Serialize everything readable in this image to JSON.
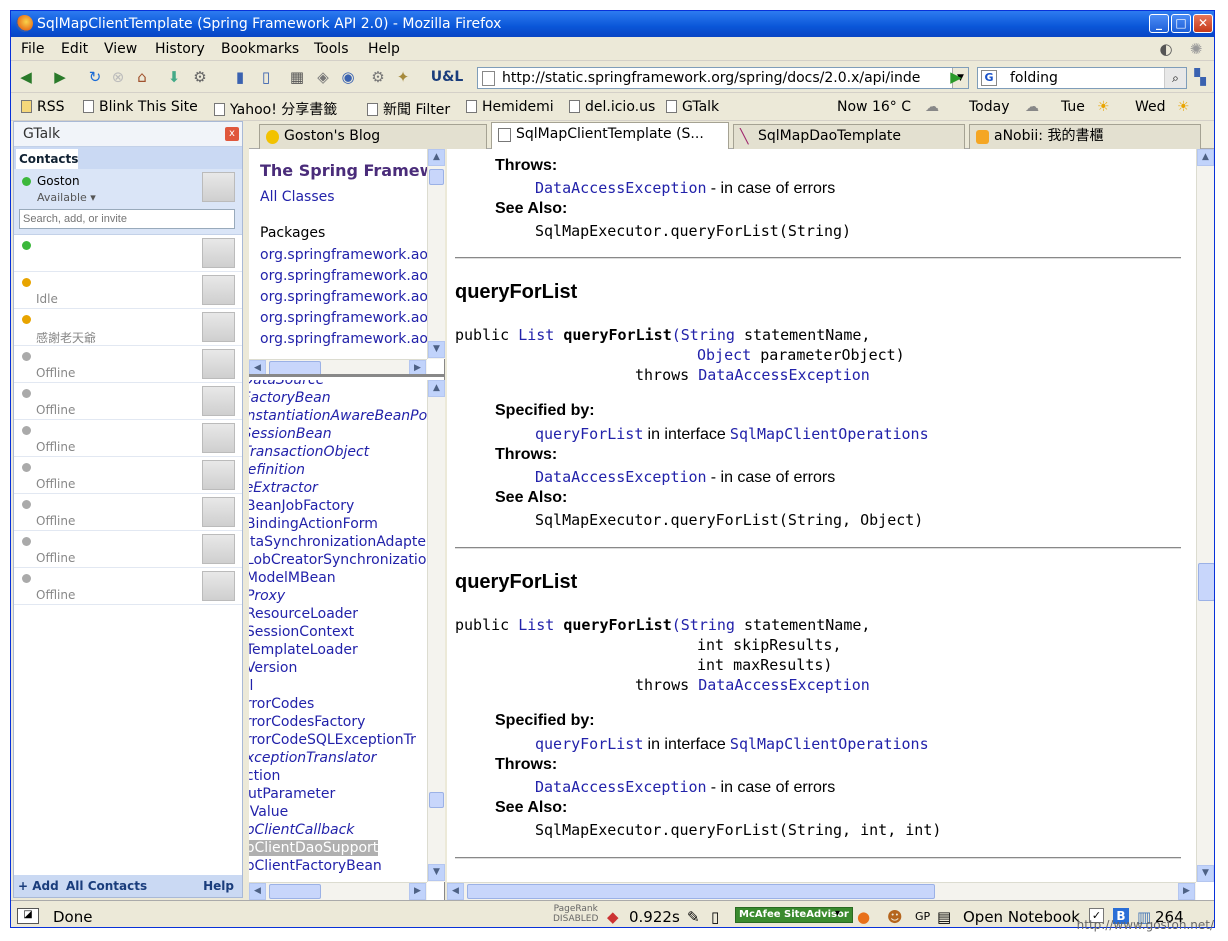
{
  "window": {
    "title": "SqlMapClientTemplate (Spring Framework API 2.0) - Mozilla Firefox"
  },
  "menu": [
    "File",
    "Edit",
    "View",
    "History",
    "Bookmarks",
    "Tools",
    "Help"
  ],
  "toolbar": {
    "url": "http://static.springframework.org/spring/docs/2.0.x/api/inde",
    "search_value": "folding",
    "search_engine": "G",
    "uql_label": "U&L"
  },
  "bookmarks": {
    "items": [
      "RSS",
      "Blink This Site",
      "Yahoo! 分享書籤",
      "新聞 Filter",
      "Hemidemi",
      "del.icio.us",
      "GTalk"
    ],
    "weather_now": "Now 16° C",
    "weather_today": "Today",
    "weather_tue": "Tue",
    "weather_wed": "Wed"
  },
  "gtalk": {
    "title": "GTalk",
    "close": "x",
    "tab": "Contacts",
    "me": {
      "name": "Goston",
      "status": "Available"
    },
    "search_placeholder": "Search, add, or invite",
    "contacts": [
      {
        "status": "",
        "presence": "online"
      },
      {
        "status": "Idle",
        "presence": "idle"
      },
      {
        "status": "感謝老天爺",
        "presence": "idle"
      },
      {
        "status": "Offline",
        "presence": "offline"
      },
      {
        "status": "Offline",
        "presence": "offline"
      },
      {
        "status": "Offline",
        "presence": "offline"
      },
      {
        "status": "Offline",
        "presence": "offline"
      },
      {
        "status": "Offline",
        "presence": "offline"
      },
      {
        "status": "Offline",
        "presence": "offline"
      },
      {
        "status": "Offline",
        "presence": "offline"
      }
    ],
    "footer": {
      "add": "+ Add",
      "all": "All Contacts",
      "help": "Help"
    }
  },
  "tabs": [
    {
      "label": "Goston's Blog",
      "active": false
    },
    {
      "label": "SqlMapClientTemplate (S...",
      "active": true
    },
    {
      "label": "SqlMapDaoTemplate",
      "active": false
    },
    {
      "label": "aNobii: 我的書櫃",
      "active": false
    }
  ],
  "package_frame": {
    "title": "The Spring Framewo",
    "all_classes": "All Classes",
    "packages_heading": "Packages",
    "packages": [
      "org.springframework.aop",
      "org.springframework.aop",
      "org.springframework.aop",
      "org.springframework.aop",
      "org.springframework.aop"
    ]
  },
  "class_frame": {
    "items": [
      {
        "text": "tDataSource",
        "italic": true
      },
      {
        "text": "tFactoryBean",
        "italic": true
      },
      {
        "text": "tInstantiationAwareBeanPo",
        "italic": true
      },
      {
        "text": "tSessionBean",
        "italic": true
      },
      {
        "text": "tTransactionObject",
        "italic": true
      },
      {
        "text": "Definition",
        "italic": true
      },
      {
        "text": "ceExtractor",
        "italic": true
      },
      {
        "text": "gBeanJobFactory",
        "italic": false
      },
      {
        "text": "gBindingActionForm",
        "italic": false
      },
      {
        "text": "gJtaSynchronizationAdapte",
        "italic": false
      },
      {
        "text": "gLobCreatorSynchronizatio",
        "italic": false
      },
      {
        "text": "gModelMBean",
        "italic": false
      },
      {
        "text": "gProxy",
        "italic": true
      },
      {
        "text": "gResourceLoader",
        "italic": false
      },
      {
        "text": "gSessionContext",
        "italic": false
      },
      {
        "text": "gTemplateLoader",
        "italic": false
      },
      {
        "text": "gVersion",
        "italic": false
      },
      {
        "text": "all",
        "italic": false
      },
      {
        "text": "ErrorCodes",
        "italic": false
      },
      {
        "text": "ErrorCodesFactory",
        "italic": false
      },
      {
        "text": "ErrorCodeSQLExceptionTr",
        "italic": false
      },
      {
        "text": "ExceptionTranslator",
        "italic": true
      },
      {
        "text": "nction",
        "italic": false
      },
      {
        "text": "OutParameter",
        "italic": false
      },
      {
        "text": "lbValue",
        "italic": false
      },
      {
        "text": "apClientCallback",
        "italic": true
      },
      {
        "text": "apClientDaoSupport",
        "italic": false,
        "selected": true
      },
      {
        "text": "apClientFactoryBean",
        "italic": false
      }
    ]
  },
  "doc": {
    "throws_label": "Throws:",
    "see_also_label": "See Also:",
    "specified_by_label": "Specified by:",
    "top": {
      "throws_exc": "DataAccessException",
      "throws_desc": "- in case of errors",
      "see_also": "SqlMapExecutor.queryForList(String)"
    },
    "methods": [
      {
        "heading": "queryForList",
        "sig_public": "public",
        "sig_type": "List",
        "sig_name": "queryForList",
        "sig_lines": [
          {
            "type": "(String",
            "rest": " statementName,"
          },
          {
            "type": "Object",
            "rest": " parameterObject)"
          }
        ],
        "throws_kw": "throws",
        "throws_exc": "DataAccessException",
        "specified_method": "queryForList",
        "specified_in": "in interface",
        "specified_iface": "SqlMapClientOperations",
        "throws_desc": "- in case of errors",
        "see_also": "SqlMapExecutor.queryForList(String, Object)"
      },
      {
        "heading": "queryForList",
        "sig_public": "public",
        "sig_type": "List",
        "sig_name": "queryForList",
        "sig_lines": [
          {
            "type": "(String",
            "rest": " statementName,"
          },
          {
            "type": "",
            "rest": "int skipResults,"
          },
          {
            "type": "",
            "rest": "int maxResults)"
          }
        ],
        "throws_kw": "throws",
        "throws_exc": "DataAccessException",
        "specified_method": "queryForList",
        "specified_in": "in interface",
        "specified_iface": "SqlMapClientOperations",
        "throws_desc": "- in case of errors",
        "see_also": "SqlMapExecutor.queryForList(String, int, int)"
      }
    ]
  },
  "status": {
    "text": "Done",
    "pagerank_label": "PageRank",
    "pagerank_state": "DISABLED",
    "timer": "0.922s",
    "mcafee": "McAfee SiteAdvisor",
    "gp": "GP",
    "notebook": "Open Notebook",
    "count": "264"
  },
  "watermark": "http://www.goston.net/"
}
